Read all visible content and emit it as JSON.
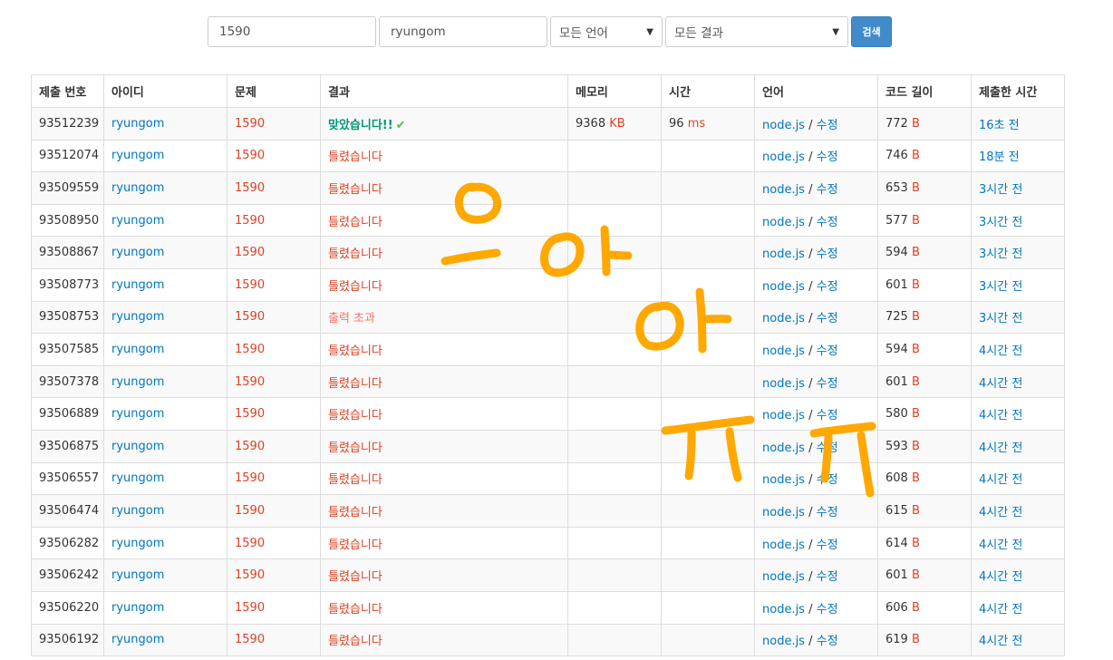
{
  "search": {
    "problem_value": "1590",
    "user_value": "ryungom",
    "language_selected": "모든 언어",
    "result_selected": "모든 결과",
    "button_label": "검색"
  },
  "table": {
    "headers": [
      "제출 번호",
      "아이디",
      "문제",
      "결과",
      "메모리",
      "시간",
      "언어",
      "코드 길이",
      "제출한 시간"
    ],
    "edit_label": "수정",
    "size_unit": "B",
    "memory_unit": "KB",
    "time_unit": "ms",
    "rows": [
      {
        "id": "93512239",
        "user": "ryungom",
        "problem": "1590",
        "result": "맞았습니다!!",
        "result_type": "ac",
        "memory": "9368",
        "time": "96",
        "lang": "node.js",
        "len": "772",
        "submitted": "16초 전"
      },
      {
        "id": "93512074",
        "user": "ryungom",
        "problem": "1590",
        "result": "틀렸습니다",
        "result_type": "wa",
        "memory": "",
        "time": "",
        "lang": "node.js",
        "len": "746",
        "submitted": "18분 전"
      },
      {
        "id": "93509559",
        "user": "ryungom",
        "problem": "1590",
        "result": "틀렸습니다",
        "result_type": "wa",
        "memory": "",
        "time": "",
        "lang": "node.js",
        "len": "653",
        "submitted": "3시간 전"
      },
      {
        "id": "93508950",
        "user": "ryungom",
        "problem": "1590",
        "result": "틀렸습니다",
        "result_type": "wa",
        "memory": "",
        "time": "",
        "lang": "node.js",
        "len": "577",
        "submitted": "3시간 전"
      },
      {
        "id": "93508867",
        "user": "ryungom",
        "problem": "1590",
        "result": "틀렸습니다",
        "result_type": "wa",
        "memory": "",
        "time": "",
        "lang": "node.js",
        "len": "594",
        "submitted": "3시간 전"
      },
      {
        "id": "93508773",
        "user": "ryungom",
        "problem": "1590",
        "result": "틀렸습니다",
        "result_type": "wa",
        "memory": "",
        "time": "",
        "lang": "node.js",
        "len": "601",
        "submitted": "3시간 전"
      },
      {
        "id": "93508753",
        "user": "ryungom",
        "problem": "1590",
        "result": "출력 초과",
        "result_type": "ole",
        "memory": "",
        "time": "",
        "lang": "node.js",
        "len": "725",
        "submitted": "3시간 전"
      },
      {
        "id": "93507585",
        "user": "ryungom",
        "problem": "1590",
        "result": "틀렸습니다",
        "result_type": "wa",
        "memory": "",
        "time": "",
        "lang": "node.js",
        "len": "594",
        "submitted": "4시간 전"
      },
      {
        "id": "93507378",
        "user": "ryungom",
        "problem": "1590",
        "result": "틀렸습니다",
        "result_type": "wa",
        "memory": "",
        "time": "",
        "lang": "node.js",
        "len": "601",
        "submitted": "4시간 전"
      },
      {
        "id": "93506889",
        "user": "ryungom",
        "problem": "1590",
        "result": "틀렸습니다",
        "result_type": "wa",
        "memory": "",
        "time": "",
        "lang": "node.js",
        "len": "580",
        "submitted": "4시간 전"
      },
      {
        "id": "93506875",
        "user": "ryungom",
        "problem": "1590",
        "result": "틀렸습니다",
        "result_type": "wa",
        "memory": "",
        "time": "",
        "lang": "node.js",
        "len": "593",
        "submitted": "4시간 전"
      },
      {
        "id": "93506557",
        "user": "ryungom",
        "problem": "1590",
        "result": "틀렸습니다",
        "result_type": "wa",
        "memory": "",
        "time": "",
        "lang": "node.js",
        "len": "608",
        "submitted": "4시간 전"
      },
      {
        "id": "93506474",
        "user": "ryungom",
        "problem": "1590",
        "result": "틀렸습니다",
        "result_type": "wa",
        "memory": "",
        "time": "",
        "lang": "node.js",
        "len": "615",
        "submitted": "4시간 전"
      },
      {
        "id": "93506282",
        "user": "ryungom",
        "problem": "1590",
        "result": "틀렸습니다",
        "result_type": "wa",
        "memory": "",
        "time": "",
        "lang": "node.js",
        "len": "614",
        "submitted": "4시간 전"
      },
      {
        "id": "93506242",
        "user": "ryungom",
        "problem": "1590",
        "result": "틀렸습니다",
        "result_type": "wa",
        "memory": "",
        "time": "",
        "lang": "node.js",
        "len": "601",
        "submitted": "4시간 전"
      },
      {
        "id": "93506220",
        "user": "ryungom",
        "problem": "1590",
        "result": "틀렸습니다",
        "result_type": "wa",
        "memory": "",
        "time": "",
        "lang": "node.js",
        "len": "606",
        "submitted": "4시간 전"
      },
      {
        "id": "93506192",
        "user": "ryungom",
        "problem": "1590",
        "result": "틀렸습니다",
        "result_type": "wa",
        "memory": "",
        "time": "",
        "lang": "node.js",
        "len": "619",
        "submitted": "4시간 전"
      }
    ]
  },
  "annotation": {
    "color": "#ffa800",
    "handwriting": "으 아 아 ㅠ ㅠ"
  }
}
